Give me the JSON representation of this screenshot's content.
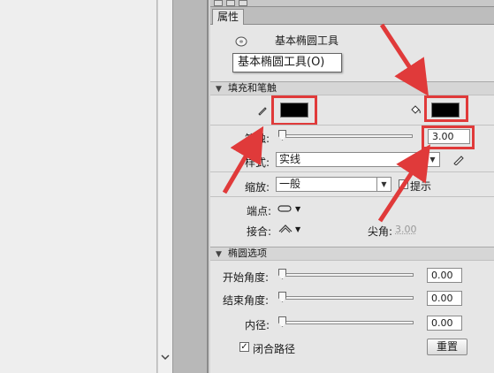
{
  "tab": {
    "label": "属性"
  },
  "tool": {
    "name": "基本椭圆工具",
    "tooltip": "基本椭圆工具(O)"
  },
  "fill_stroke": {
    "header": "填充和笔触",
    "stroke_color": "#000000",
    "fill_color": "#000000",
    "stroke_label": "笔触:",
    "stroke_value": "3.00",
    "style_label": "样式:",
    "style_value": "实线",
    "scale_label": "缩放:",
    "scale_value": "一般",
    "hint_label": "提示",
    "cap_label": "端点:",
    "join_label": "接合:",
    "miter_label": "尖角:",
    "miter_value": "3.00"
  },
  "ellipse": {
    "header": "椭圆选项",
    "start_label": "开始角度:",
    "start_value": "0.00",
    "end_label": "结束角度:",
    "end_value": "0.00",
    "inner_label": "内径:",
    "inner_value": "0.00",
    "close_path_label": "闭合路径",
    "reset_label": "重置"
  },
  "colors": {
    "annotation": "#e03a3a",
    "panel_bg": "#e6e6e6"
  }
}
